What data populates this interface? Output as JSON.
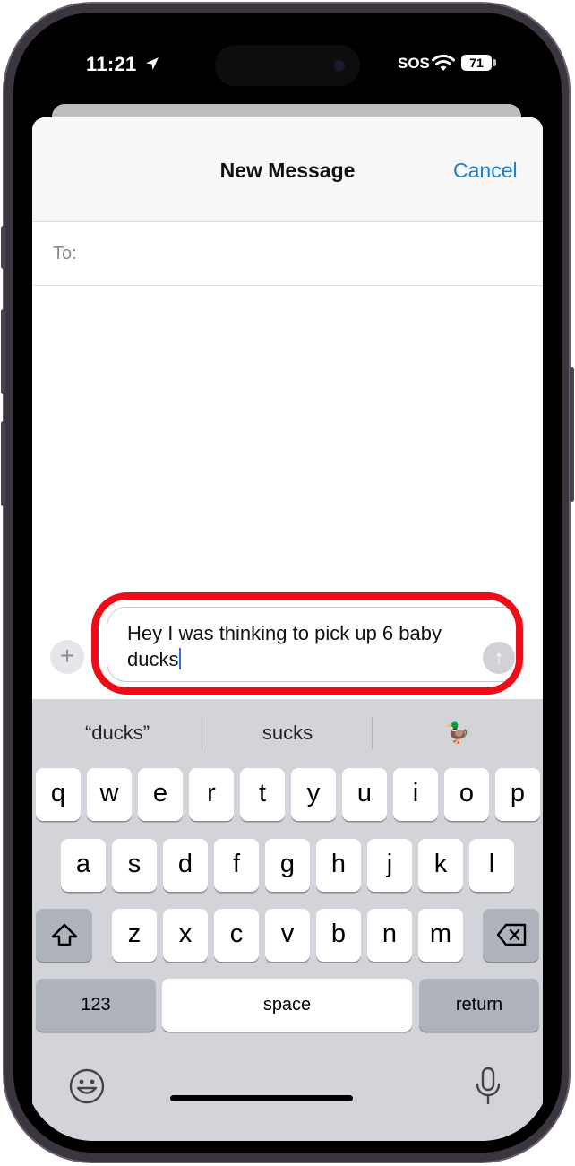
{
  "status_bar": {
    "time": "11:21",
    "carrier": "SOS",
    "battery": "71"
  },
  "compose": {
    "title": "New Message",
    "cancel_label": "Cancel",
    "to_label": "To:",
    "message_text": "Hey I was thinking to pick up 6 baby ducks",
    "plus_label": "+",
    "send_label": "↑"
  },
  "keyboard": {
    "suggestions": [
      "“ducks”",
      "sucks",
      "🦆"
    ],
    "row1": [
      "q",
      "w",
      "e",
      "r",
      "t",
      "y",
      "u",
      "i",
      "o",
      "p"
    ],
    "row2": [
      "a",
      "s",
      "d",
      "f",
      "g",
      "h",
      "j",
      "k",
      "l"
    ],
    "row3": [
      "z",
      "x",
      "c",
      "v",
      "b",
      "n",
      "m"
    ],
    "numbers_label": "123",
    "space_label": "space",
    "return_label": "return"
  },
  "colors": {
    "accent": "#1a7fd4",
    "highlight": "#ee0d16",
    "keyboard_bg": "#d2d4da"
  }
}
